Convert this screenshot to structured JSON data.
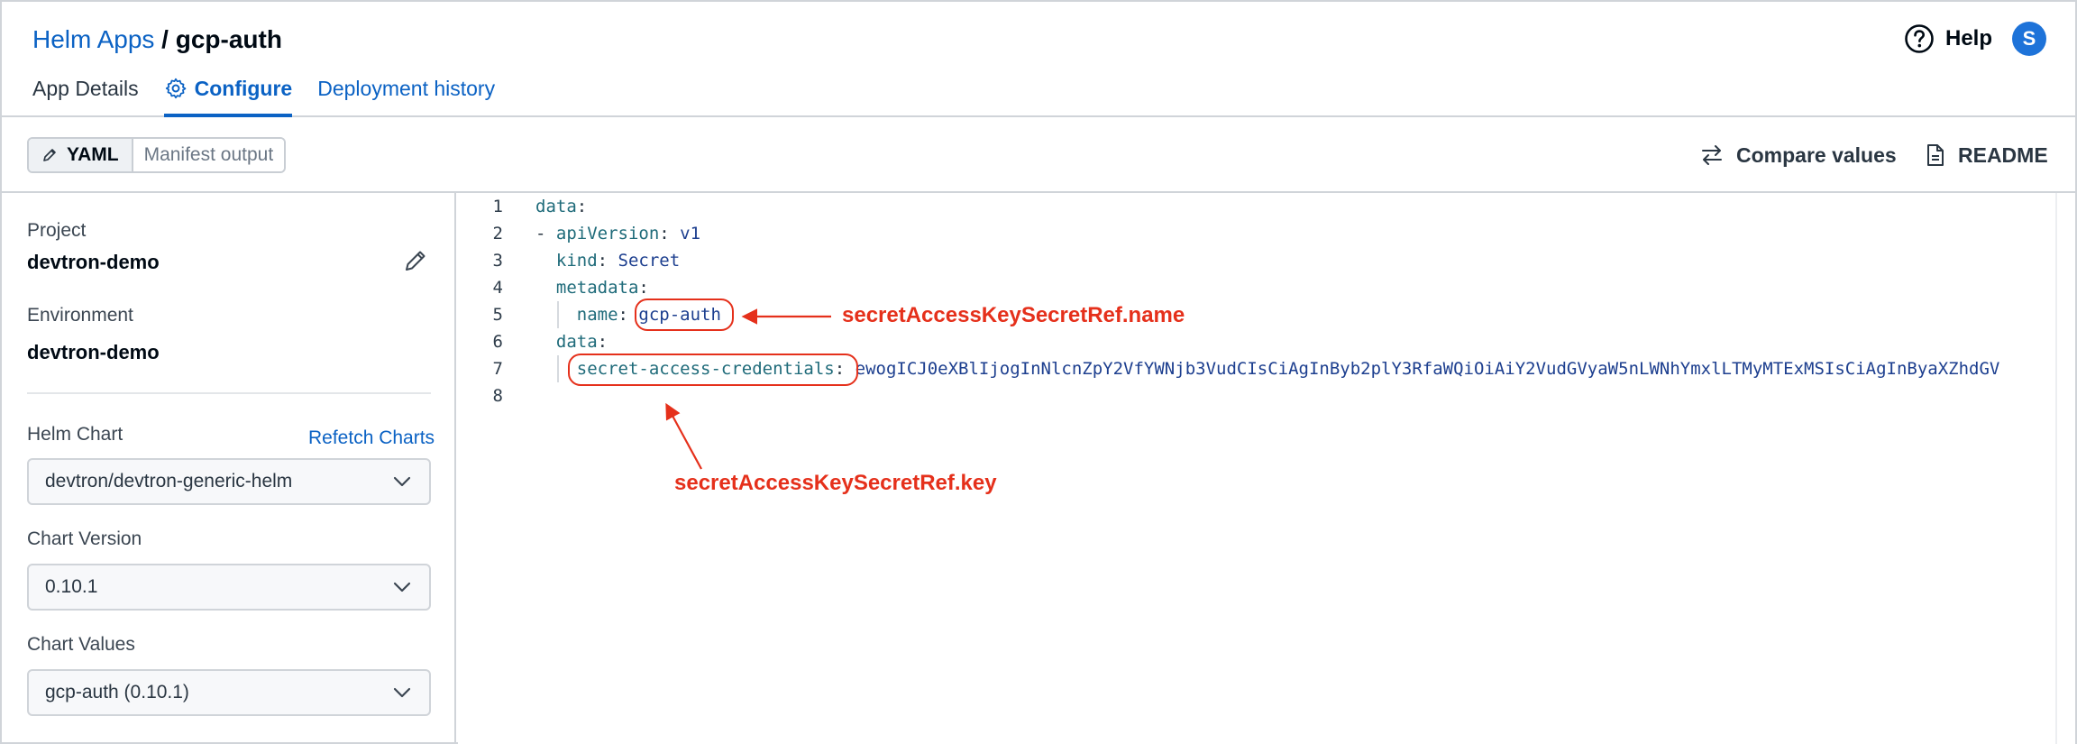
{
  "header": {
    "breadcrumb_root": "Helm Apps",
    "breadcrumb_sep": " / ",
    "breadcrumb_current": "gcp-auth",
    "help_label": "Help",
    "avatar_initial": "S"
  },
  "tabs": [
    {
      "label": "App Details",
      "active": false
    },
    {
      "label": "Configure",
      "active": true,
      "icon": "gear-icon"
    },
    {
      "label": "Deployment history",
      "active": false
    }
  ],
  "toolbar": {
    "yaml_label": "YAML",
    "manifest_label": "Manifest output",
    "compare_label": "Compare values",
    "readme_label": "README"
  },
  "sidebar": {
    "project_label": "Project",
    "project_value": "devtron-demo",
    "environment_label": "Environment",
    "environment_value": "devtron-demo",
    "helm_chart_label": "Helm Chart",
    "refetch_label": "Refetch Charts",
    "helm_chart_value": "devtron/devtron-generic-helm",
    "chart_version_label": "Chart Version",
    "chart_version_value": "0.10.1",
    "chart_values_label": "Chart Values",
    "chart_values_value": "gcp-auth (0.10.1)"
  },
  "editor": {
    "line_numbers": [
      "1",
      "2",
      "3",
      "4",
      "5",
      "6",
      "7",
      "8"
    ],
    "l1_key": "data",
    "l2_dash": "- ",
    "l2_key": "apiVersion",
    "l2_val": "v1",
    "l3_key": "kind",
    "l3_val": "Secret",
    "l4_key": "metadata",
    "l5_key": "name",
    "l5_val": "gcp-auth",
    "l6_key": "data",
    "l7_key": "secret-access-credentials",
    "l7_val": "ewogICJ0eXBlIjogInNlcnZpY2VfYWNjb3VudCIsCiAgInByb2plY3RfaWQiOiAiY2VudGVyaW5nLWNhYmxlLTMyMTExMSIsCiAgInByaXZhdGV"
  },
  "annotations": {
    "name_note": "secretAccessKeySecretRef.name",
    "key_note": "secretAccessKeySecretRef.key",
    "color": "#e5301b"
  },
  "colors": {
    "accent": "#0b62c4",
    "avatar_bg": "#1e73d9",
    "border": "#d0d4d9"
  }
}
